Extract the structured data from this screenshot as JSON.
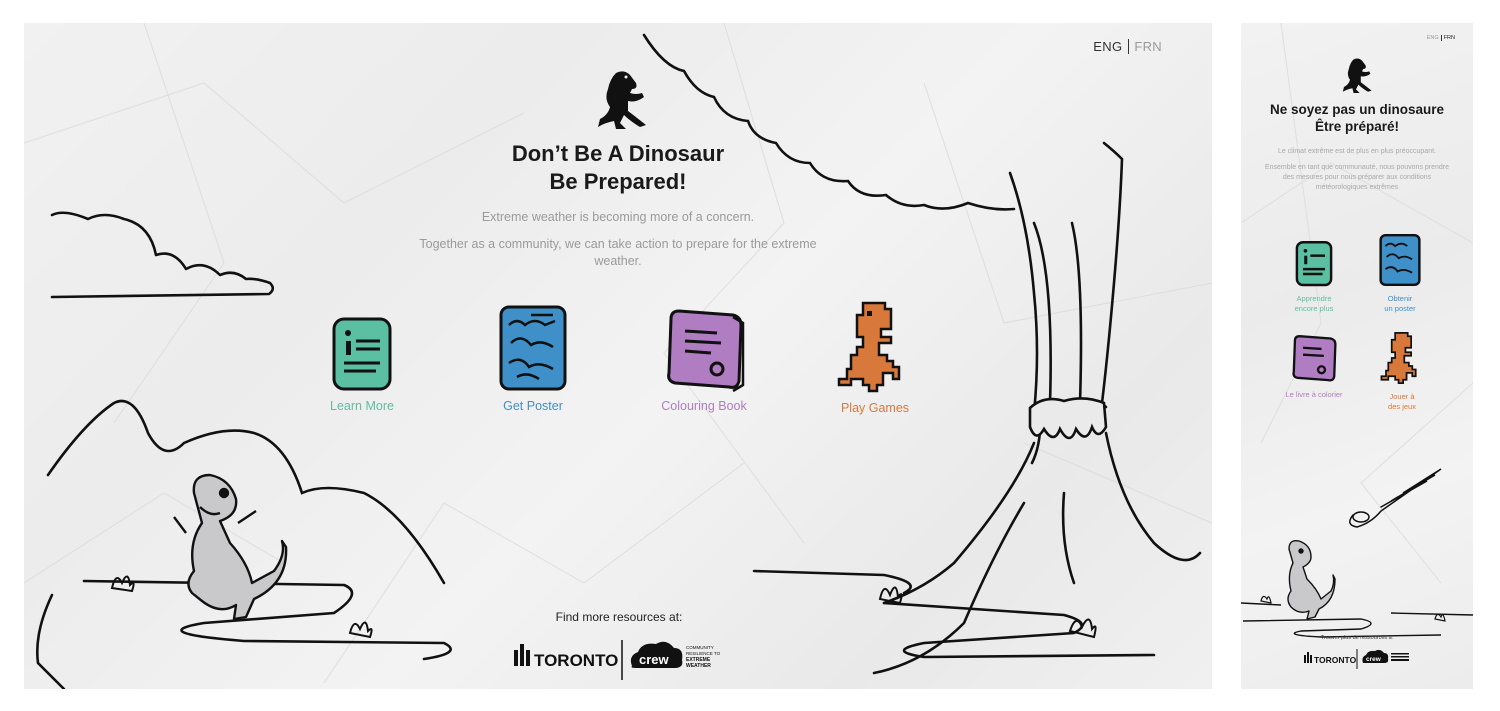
{
  "desktop": {
    "lang": {
      "eng": "ENG",
      "frn": "FRN"
    },
    "title_line1": "Don’t Be A Dinosaur",
    "title_line2": "Be Prepared!",
    "sub1": "Extreme weather is becoming more of a concern.",
    "sub2": "Together as a community, we can take action to prepare for the extreme weather.",
    "cards": [
      {
        "label": "Learn More",
        "color": "#5bbfa1"
      },
      {
        "label": "Get Poster",
        "color": "#3f8fc9"
      },
      {
        "label": "Colouring Book",
        "color": "#b07cc2"
      },
      {
        "label": "Play Games",
        "color": "#d8783a"
      }
    ],
    "footer": "Find more resources at:",
    "logo_toronto": "TORONTO",
    "logo_crew": "crew",
    "logo_crew_tag": [
      "COMMUNITY",
      "RESILIENCE TO",
      "EXTREME",
      "WEATHER"
    ]
  },
  "mobile": {
    "lang": {
      "eng": "ENG",
      "frn": "FRN"
    },
    "title_line1": "Ne soyez pas un dinosaure",
    "title_line2": "Être préparé!",
    "sub1": "Le climat extrême est de plus en plus préoccupant.",
    "sub2": "Ensemble en tant que communauté, nous pouvons prendre des mesures pour nous préparer aux conditions météorologiques extrêmes",
    "cards": [
      {
        "label": "Apprendre\nencore plus",
        "color": "#5bbfa1"
      },
      {
        "label": "Obtenir\nun poster",
        "color": "#3f8fc9"
      },
      {
        "label": "Le livre à colorier",
        "color": "#b07cc2"
      },
      {
        "label": "Jouer à\ndes jeux",
        "color": "#d8783a"
      }
    ],
    "footer": "Trouver plus de ressources à:",
    "logo_toronto": "TORONTO",
    "logo_crew": "crew"
  }
}
